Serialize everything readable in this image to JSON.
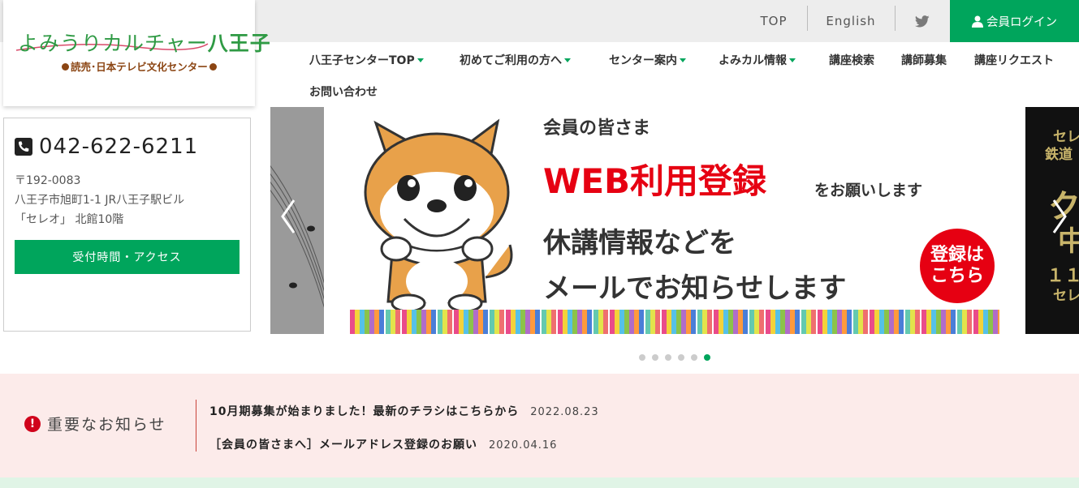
{
  "logo": {
    "main_text": "よみうりカルチャー",
    "main_bold": "八王子",
    "sub_text": "読売･日本テレビ文化センター"
  },
  "utility_nav": {
    "top_label": "TOP",
    "english_label": "English",
    "twitter_icon": "twitter-bird-icon",
    "login_label": "会員ログイン"
  },
  "main_nav": {
    "items": [
      {
        "label": "八王子センターTOP",
        "dropdown": true
      },
      {
        "label": "初めてご利用の方へ",
        "dropdown": true
      },
      {
        "label": "センター案内",
        "dropdown": true
      },
      {
        "label": "よみカル情報",
        "dropdown": true
      },
      {
        "label": "講座検索",
        "dropdown": false
      },
      {
        "label": "講師募集",
        "dropdown": false
      },
      {
        "label": "講座リクエスト",
        "dropdown": false
      },
      {
        "label": "お問い合わせ",
        "dropdown": false
      }
    ]
  },
  "contact": {
    "phone": "042-622-6211",
    "postal": "〒192-0083",
    "address_line1": "八王子市旭町1-1 JR八王子駅ビル",
    "address_line2": "「セレオ」 北館10階",
    "access_button": "受付時間・アクセス"
  },
  "slider": {
    "heading": "会員の皆さま",
    "highlight": "WEB利用登録",
    "highlight_suffix": "をお願いします",
    "line3": "休講情報などを",
    "line4": "メールでお知らせします",
    "badge_line1": "登録は",
    "badge_line2": "こちら",
    "right_peek_1": "セレ",
    "right_peek_2": "鉄道",
    "right_peek_3": "ク",
    "right_peek_4": "中",
    "right_peek_5": "１１",
    "right_peek_6": "セレ",
    "slide_count": 6,
    "active_slide": 6
  },
  "notice": {
    "title": "重要なお知らせ",
    "items": [
      {
        "text": "10月期募集が始まりました！最新のチラシはこちらから",
        "date": "2022.08.23"
      },
      {
        "text": "［会員の皆さまへ］メールアドレス登録のお願い",
        "date": "2020.04.16"
      }
    ]
  },
  "colors": {
    "brand_green": "#00a55c",
    "accent_red": "#e60012",
    "notice_bg": "#fcebea"
  }
}
